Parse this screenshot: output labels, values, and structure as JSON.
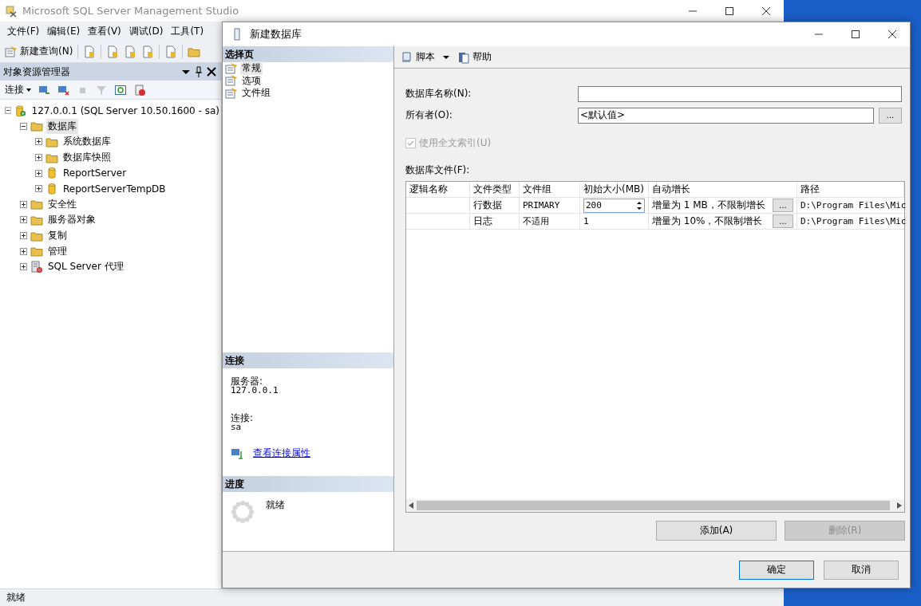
{
  "main_window": {
    "title": "Microsoft SQL Server Management Studio",
    "menu": [
      "文件(F)",
      "编辑(E)",
      "查看(V)",
      "调试(D)",
      "工具(T)"
    ],
    "toolbar": {
      "new_query": "新建查询(N)"
    },
    "object_explorer": {
      "title": "对象资源管理器",
      "connect": "连接",
      "tree": [
        {
          "label": "127.0.0.1 (SQL Server 10.50.1600 - sa)",
          "kind": "server",
          "expanded": true,
          "selected": false,
          "children": [
            {
              "label": "数据库",
              "kind": "folder",
              "expanded": true,
              "selected": true,
              "children": [
                {
                  "label": "系统数据库",
                  "kind": "folder",
                  "expanded": false,
                  "selected": false
                },
                {
                  "label": "数据库快照",
                  "kind": "folder",
                  "expanded": false,
                  "selected": false
                },
                {
                  "label": "ReportServer",
                  "kind": "database",
                  "expanded": false,
                  "selected": false
                },
                {
                  "label": "ReportServerTempDB",
                  "kind": "database",
                  "expanded": false,
                  "selected": false
                }
              ]
            },
            {
              "label": "安全性",
              "kind": "folder",
              "expanded": false,
              "selected": false
            },
            {
              "label": "服务器对象",
              "kind": "folder",
              "expanded": false,
              "selected": false
            },
            {
              "label": "复制",
              "kind": "folder",
              "expanded": false,
              "selected": false
            },
            {
              "label": "管理",
              "kind": "folder",
              "expanded": false,
              "selected": false
            },
            {
              "label": "SQL Server 代理",
              "kind": "agent",
              "expanded": false,
              "selected": false
            }
          ]
        }
      ]
    },
    "status_bar": "就绪"
  },
  "dialog": {
    "title": "新建数据库",
    "select_page": {
      "title": "选择页",
      "pages": [
        {
          "label": "常规",
          "selected": true
        },
        {
          "label": "选项",
          "selected": false
        },
        {
          "label": "文件组",
          "selected": false
        }
      ]
    },
    "connection": {
      "title": "连接",
      "server_label": "服务器:",
      "server": "127.0.0.1",
      "login_label": "连接:",
      "login": "sa",
      "link": "查看连接属性"
    },
    "progress": {
      "title": "进度",
      "status": "就绪"
    },
    "toolbar": {
      "script": "脚本",
      "help": "帮助"
    },
    "form": {
      "name_label": "数据库名称(N):",
      "owner_label": "所有者(O):",
      "owner_value": "<默认值>",
      "browse": "...",
      "fulltext": {
        "label": "使用全文索引(U)",
        "checked": true,
        "disabled": true
      }
    },
    "files": {
      "label": "数据库文件(F):",
      "columns": [
        "逻辑名称",
        "文件类型",
        "文件组",
        "初始大小(MB)",
        "自动增长",
        "路径"
      ],
      "rows": [
        {
          "type": "行数据",
          "filegroup": "PRIMARY",
          "size": "200",
          "editing": true,
          "growth": "增量为 1 MB，不限制增长",
          "browse": "...",
          "path": "D:\\Program Files\\Mic"
        },
        {
          "type": "日志",
          "filegroup": "不适用",
          "size": "1",
          "editing": false,
          "growth": "增量为 10%，不限制增长",
          "browse": "...",
          "path": "D:\\Program Files\\Mic"
        }
      ]
    },
    "add": {
      "label": "添加(A)",
      "disabled": false
    },
    "remove": {
      "label": "删除(R)",
      "disabled": true
    },
    "ok": "确定",
    "cancel": "取消"
  }
}
